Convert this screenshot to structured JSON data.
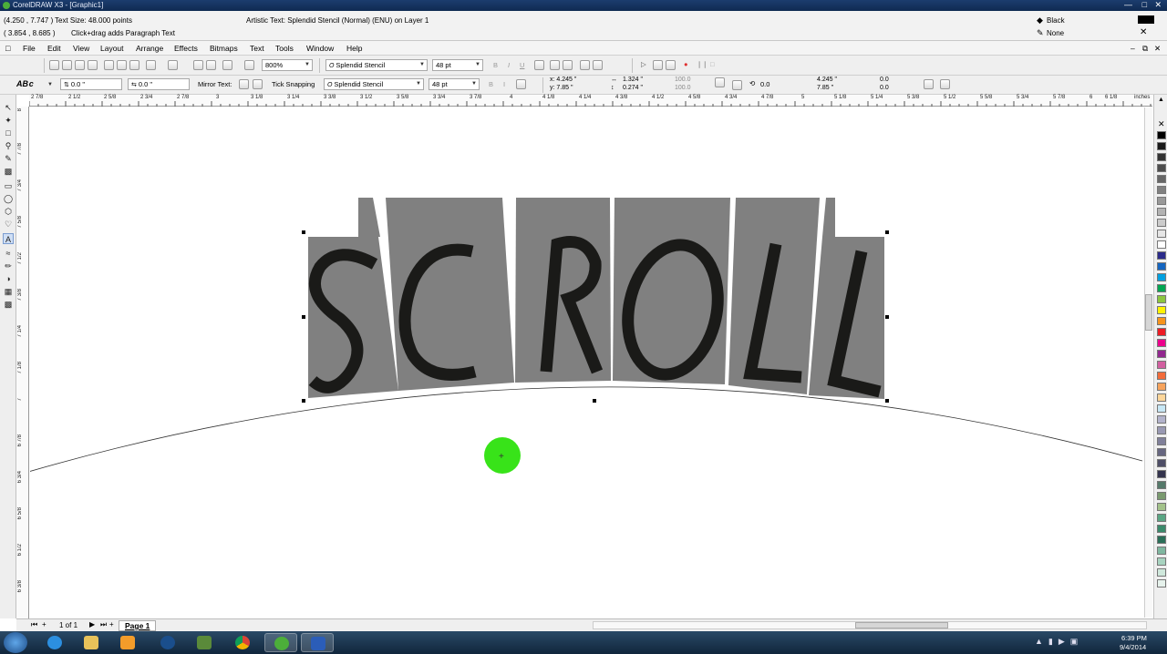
{
  "window": {
    "title": "CorelDRAW X3 - [Graphic1]"
  },
  "status": {
    "cursor_position": "(4.250 , 7.747 )",
    "text_size": "Text Size: 48.000 points",
    "object_position": "( 3.854 , 8.685 )",
    "hint": "Click+drag adds Paragraph Text",
    "object_info": "Artistic Text: Splendid Stencil (Normal) (ENU) on Layer 1",
    "fill_label": "Black",
    "outline_label": "None"
  },
  "menu": {
    "items": [
      "File",
      "Edit",
      "View",
      "Layout",
      "Arrange",
      "Effects",
      "Bitmaps",
      "Text",
      "Tools",
      "Window",
      "Help"
    ]
  },
  "toolbar1": {
    "zoom": "800%",
    "font": "Splendid Stencil",
    "size": "48 pt"
  },
  "toolbar2": {
    "offset_h": "0.0 \"",
    "offset_v": "0.0 \"",
    "mirror_label": "Mirror Text:",
    "tick_label": "Tick Snapping",
    "font": "Splendid Stencil",
    "size": "48 pt",
    "x": "x: 4.245 \"",
    "y": "y: 7.85 \"",
    "w": "1.324 \"",
    "h": "0.274 \"",
    "sx": "100.0",
    "sy": "100.0",
    "rotation": "0.0",
    "cx": "4.245 \"",
    "cy": "7.85 \"",
    "dx": "0.0",
    "dy": "0.0"
  },
  "ruler": {
    "unit": "inches",
    "h_labels": [
      "2 7/8",
      "2 1/2",
      "2 5/8",
      "2 3/4",
      "2 7/8",
      "3",
      "3 1/8",
      "3 1/4",
      "3 3/8",
      "3 1/2",
      "3 5/8",
      "3 3/4",
      "3 7/8",
      "4",
      "4 1/8",
      "4 1/4",
      "4 3/8",
      "4 1/2",
      "4 5/8",
      "4 3/4",
      "4 7/8",
      "5",
      "5 1/8",
      "5 1/4",
      "5 3/8",
      "5 1/2",
      "5 5/8",
      "5 3/4",
      "5 7/8",
      "6",
      "6 1/8",
      "6 1/4"
    ],
    "v_labels": [
      "8",
      "7 7/8",
      "7 3/4",
      "7 5/8",
      "7 1/2",
      "7 3/8",
      "7 1/4",
      "7 1/8",
      "7",
      "6 7/8",
      "6 3/4",
      "6 5/8",
      "6 1/2",
      "6 3/8",
      "6 1/4"
    ]
  },
  "artwork": {
    "text": "SCROLL",
    "letters": [
      "S",
      "C",
      "R",
      "O",
      "L",
      "L"
    ],
    "fill_color": "#808080",
    "glyph_color": "#1a1a18"
  },
  "pagebar": {
    "counter": "1 of 1",
    "page_tab": "Page 1"
  },
  "taskbar": {
    "time": "6:39 PM",
    "date": "9/4/2014"
  },
  "palette": [
    "#000000",
    "#1a1a1a",
    "#333333",
    "#4d4d4d",
    "#666666",
    "#808080",
    "#999999",
    "#b3b3b3",
    "#cccccc",
    "#e6e6e6",
    "#ffffff",
    "#2b2b8a",
    "#1565c0",
    "#00a0e0",
    "#00a651",
    "#8cc63f",
    "#fff200",
    "#f7941d",
    "#ed1c24",
    "#ec008c",
    "#92278f",
    "#d25fa0",
    "#f26b3a",
    "#f7a35c",
    "#fdd69a",
    "#c7e7f5",
    "#b3b3cc",
    "#9999b3",
    "#80809a",
    "#666680",
    "#4d4d66",
    "#33334d",
    "#55796a",
    "#7a9a6f",
    "#a3c28a",
    "#5aa684",
    "#3a8a6b",
    "#2a6e57",
    "#7fb7a0",
    "#a8d3c0",
    "#cfe8dc",
    "#e6f2ec"
  ],
  "colors": {
    "cursor_highlight": "#22e000",
    "titlebar": "#1c3d6e",
    "taskbar": "#1b3550"
  }
}
